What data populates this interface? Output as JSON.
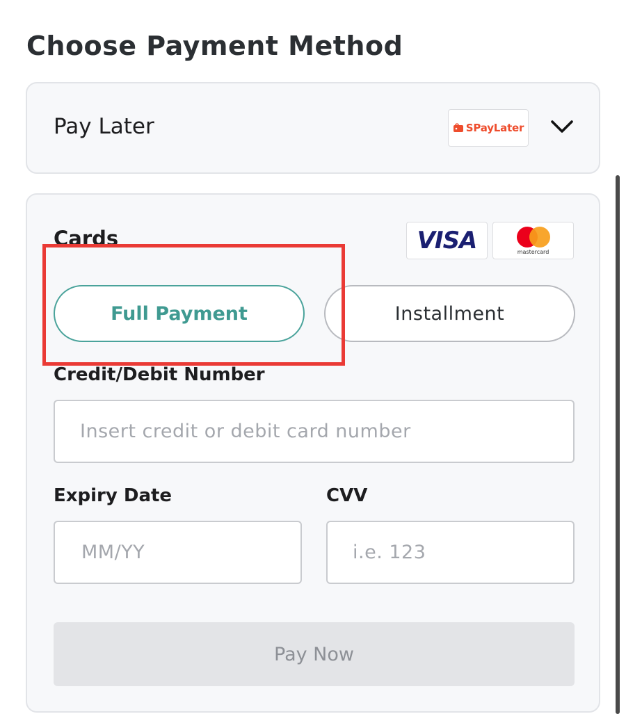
{
  "page": {
    "title": "Choose Payment Method"
  },
  "pay_later": {
    "label": "Pay Later",
    "logo_text": "SPayLater",
    "logo_icon": "shop-bag-icon",
    "expand_icon": "chevron-down-icon"
  },
  "cards": {
    "label": "Cards",
    "brand_logos": [
      "VISA",
      "mastercard"
    ],
    "payment_options": [
      {
        "label": "Full Payment",
        "selected": true
      },
      {
        "label": "Installment",
        "selected": false
      }
    ],
    "card_number": {
      "label": "Credit/Debit Number",
      "placeholder": "Insert credit or debit card number",
      "value": ""
    },
    "expiry": {
      "label": "Expiry Date",
      "placeholder": "MM/YY",
      "value": ""
    },
    "cvv": {
      "label": "CVV",
      "placeholder": "i.e. 123",
      "value": ""
    },
    "submit_label": "Pay Now"
  },
  "colors": {
    "accent": "#4aa39b",
    "highlight": "#ea3a35",
    "brand_shopee": "#ee4d2d",
    "visa_blue": "#1a1f71"
  }
}
